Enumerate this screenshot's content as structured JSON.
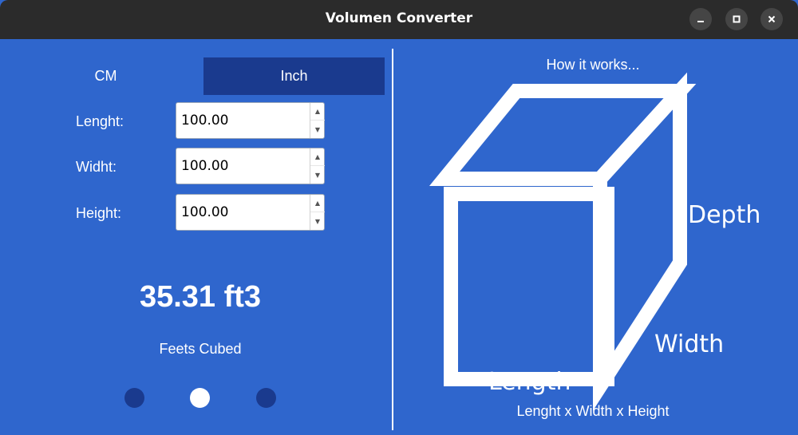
{
  "window": {
    "title": "Volumen Converter",
    "controls": [
      "minimize",
      "maximize",
      "close"
    ]
  },
  "tabs": [
    {
      "label": "CM",
      "selected": false
    },
    {
      "label": "Inch",
      "selected": true
    }
  ],
  "fields": [
    {
      "label": "Lenght:",
      "value": "100.00"
    },
    {
      "label": "Widht:",
      "value": "100.00"
    },
    {
      "label": "Height:",
      "value": "100.00"
    }
  ],
  "result": {
    "value": "35.31 ft3",
    "caption": "Feets Cubed"
  },
  "pager": {
    "count": 3,
    "active_index": 1
  },
  "info": {
    "heading": "How it works...",
    "cube_labels": {
      "depth": "Depth",
      "width": "Width",
      "length": "Length"
    },
    "formula": "Lenght x Width x Height"
  },
  "colors": {
    "background": "#2f66cd",
    "selected_tab": "#1a3a8e",
    "titlebar": "#2b2b2b"
  }
}
